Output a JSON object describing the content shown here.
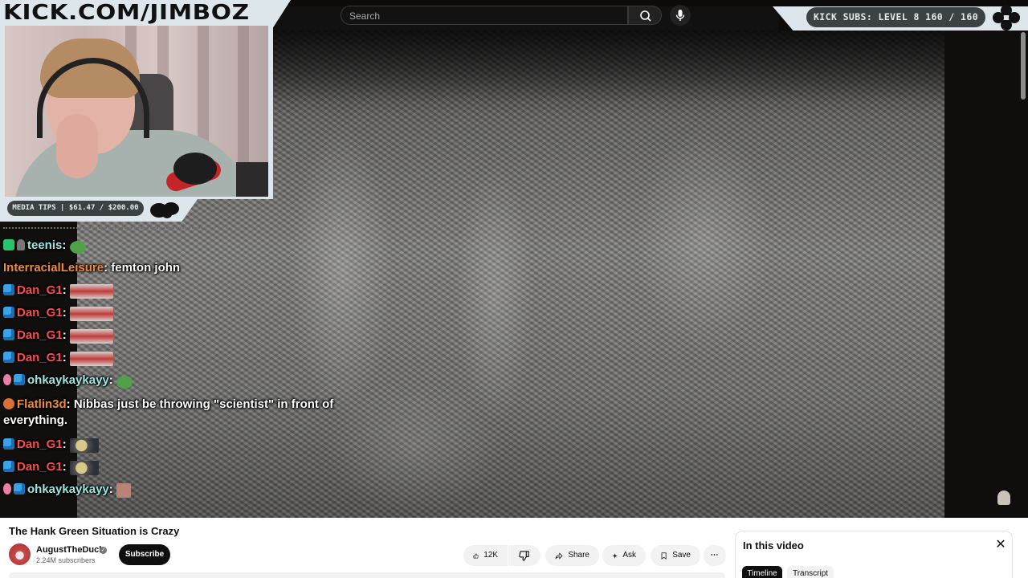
{
  "overlay": {
    "brand": "KICK.COM/JIMBOZ",
    "kick_subs": "KICK SUBS: LEVEL 8 160 / 160",
    "media_tips": "MEDIA TIPS | $61.47 / $200.00"
  },
  "search": {
    "placeholder": "Search"
  },
  "chat": [
    {
      "badges": [
        "green",
        "man"
      ],
      "user": "teenis",
      "user_color": "#9fe7e2",
      "text": "",
      "emote": "pepe"
    },
    {
      "badges": [],
      "user": "InterracialLeisure",
      "user_color": "#f08a3c",
      "text": "femton john",
      "emote": ""
    },
    {
      "badges": [
        "cube"
      ],
      "user": "Dan_G1",
      "user_color": "#ff4b4b",
      "text": "",
      "emote": "strip"
    },
    {
      "badges": [
        "cube"
      ],
      "user": "Dan_G1",
      "user_color": "#ff4b4b",
      "text": "",
      "emote": "strip"
    },
    {
      "badges": [
        "cube"
      ],
      "user": "Dan_G1",
      "user_color": "#ff4b4b",
      "text": "",
      "emote": "strip"
    },
    {
      "badges": [
        "cube"
      ],
      "user": "Dan_G1",
      "user_color": "#ff4b4b",
      "text": "",
      "emote": "strip"
    },
    {
      "badges": [
        "pink",
        "cube"
      ],
      "user": "ohkaykaykayy",
      "user_color": "#9fe7e2",
      "text": "",
      "emote": "pepe"
    },
    {
      "badges": [
        "burger"
      ],
      "user": "Flatlin3d",
      "user_color": "#f08a3c",
      "text": "Nibbas just be throwing \"scientist\" in front of",
      "emote": ""
    },
    {
      "badges": [],
      "user": "",
      "user_color": "#ffffff",
      "text": "everything.",
      "emote": ""
    },
    {
      "badges": [
        "cube"
      ],
      "user": "Dan_G1",
      "user_color": "#ff4b4b",
      "text": "",
      "emote": "blob"
    },
    {
      "badges": [
        "cube"
      ],
      "user": "Dan_G1",
      "user_color": "#ff4b4b",
      "text": "",
      "emote": "blob"
    },
    {
      "badges": [
        "pink",
        "cube"
      ],
      "user": "ohkaykaykayy",
      "user_color": "#9fe7e2",
      "text": "",
      "emote": "face"
    }
  ],
  "video": {
    "title": "The Hank Green Situation is Crazy",
    "channel": "AugustTheDuck",
    "subscribers": "2.24M subscribers",
    "subscribe_label": "Subscribe",
    "likes": "12K",
    "share_label": "Share",
    "ask_label": "Ask",
    "save_label": "Save",
    "more_label": "⋯"
  },
  "side_panel": {
    "title": "In this video",
    "close": "✕",
    "tabs": [
      "Timeline",
      "Transcript"
    ]
  },
  "icons": {
    "search": "search-icon",
    "mic": "mic-icon",
    "like": "thumbs-up-icon",
    "dislike": "thumbs-down-icon",
    "share": "share-icon",
    "ask": "sparkle-icon",
    "save": "bookmark-icon",
    "verified": "verified-icon"
  },
  "colors": {
    "overlay_bg": "#dde6ea",
    "pill_bg": "#3c4244",
    "username_red": "#ff4b4b",
    "username_teal": "#9fe7e2",
    "username_orange": "#f08a3c"
  }
}
